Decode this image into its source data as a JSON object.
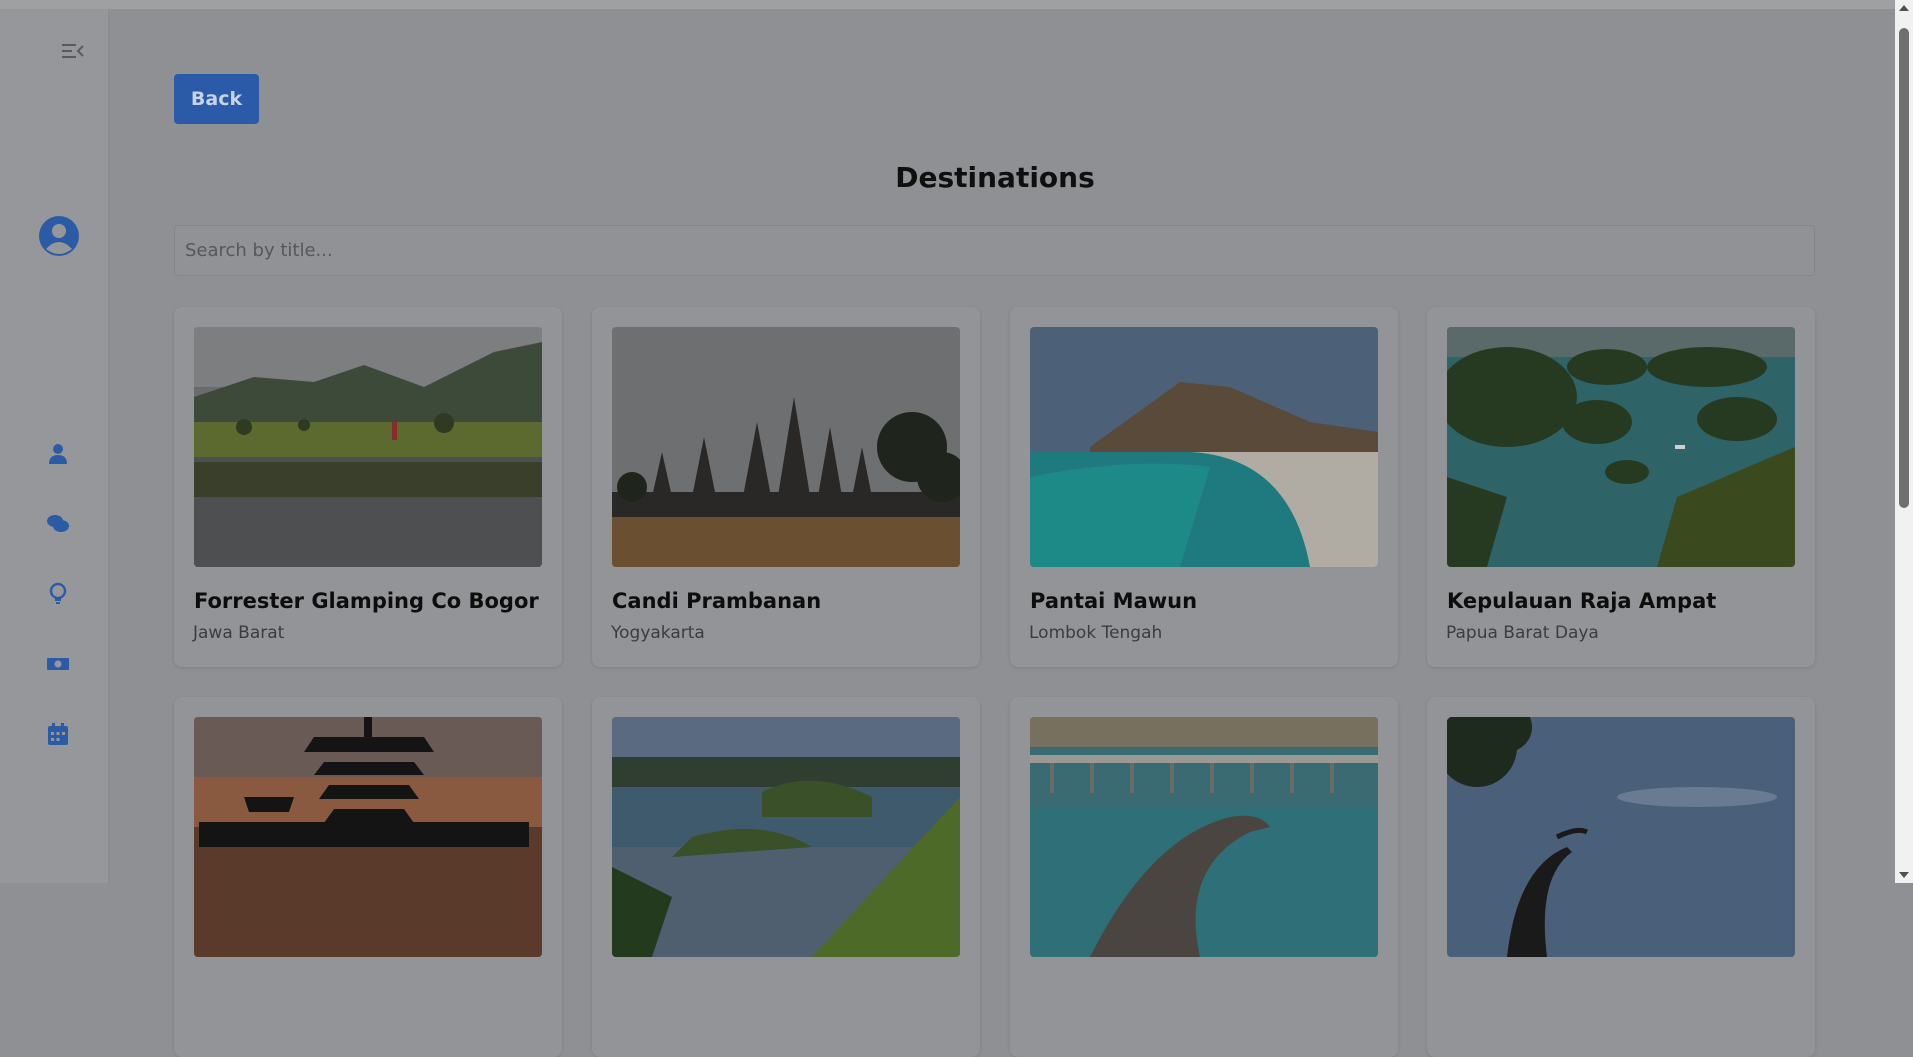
{
  "sidebar": {
    "icons": [
      "menu-collapse-icon",
      "user-circle-icon",
      "user-icon",
      "comments-icon",
      "lightbulb-icon",
      "money-bill-icon",
      "calendar-icon"
    ]
  },
  "main": {
    "back_label": "Back",
    "title": "Destinations",
    "search_placeholder": "Search by title..."
  },
  "cards": [
    {
      "title": "Forrester Glamping Co Bogor",
      "region": "Jawa Barat",
      "image": "lake-mountains"
    },
    {
      "title": "Candi Prambanan",
      "region": "Yogyakarta",
      "image": "temple"
    },
    {
      "title": "Pantai Mawun",
      "region": "Lombok Tengah",
      "image": "beach"
    },
    {
      "title": "Kepulauan Raja Ampat",
      "region": "Papua Barat Daya",
      "image": "islands"
    },
    {
      "title": "",
      "region": "",
      "image": "bali-temple-sunset"
    },
    {
      "title": "",
      "region": "",
      "image": "lake-toba"
    },
    {
      "title": "",
      "region": "",
      "image": "komodo-pier"
    },
    {
      "title": "",
      "region": "",
      "image": "tree-sky"
    }
  ],
  "colors": {
    "overlay_bg": "#8f9093",
    "accent": "#2b5aa8",
    "icon": "#2c5ba6"
  }
}
